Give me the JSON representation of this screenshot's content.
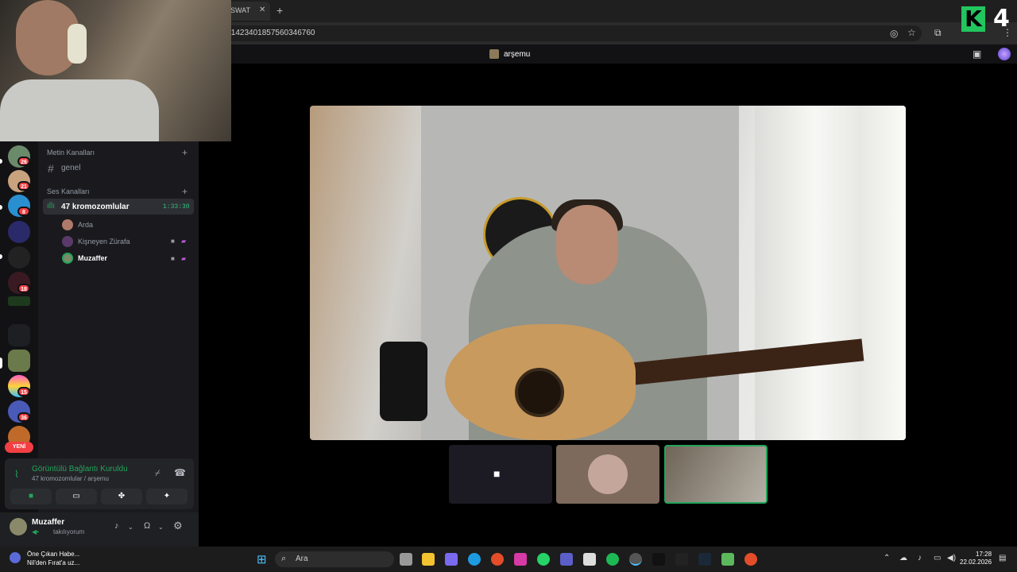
{
  "browser": {
    "tab_title": "SWAT",
    "url": "/1423401857560346760",
    "new_tab": "+",
    "close": "✕",
    "overlay_letter": "K",
    "overlay_number": "4"
  },
  "header": {
    "channel_name": "arşemu"
  },
  "sidebar": {
    "text_category": "Metin Kanalları",
    "text_channel": "genel",
    "voice_category": "Ses Kanalları",
    "voice_channel": "47 kromozomlular",
    "voice_timer": "1:33:30",
    "members": [
      "Arda",
      "Kişneyen Zürafa",
      "Muzaffer"
    ]
  },
  "servers": {
    "badges": [
      "26",
      "21",
      "8",
      "18",
      "15",
      "36"
    ],
    "new_label": "YENİ"
  },
  "voice_panel": {
    "status": "Görüntülü Bağlantı Kuruldu",
    "location": "47 kromozomlular / arşemu"
  },
  "user": {
    "name": "Muzaffer",
    "status": "takılıyorum"
  },
  "taskbar": {
    "news_title": "Öne Çıkan Habe...",
    "news_sub": "Nil'den Fırat'a uz...",
    "search_placeholder": "Ara",
    "time": "17:28",
    "date": "22.02.2026"
  },
  "colors": {
    "accent": "#23a55a",
    "badge": "#f23f43",
    "highlight": "#22c55e"
  }
}
